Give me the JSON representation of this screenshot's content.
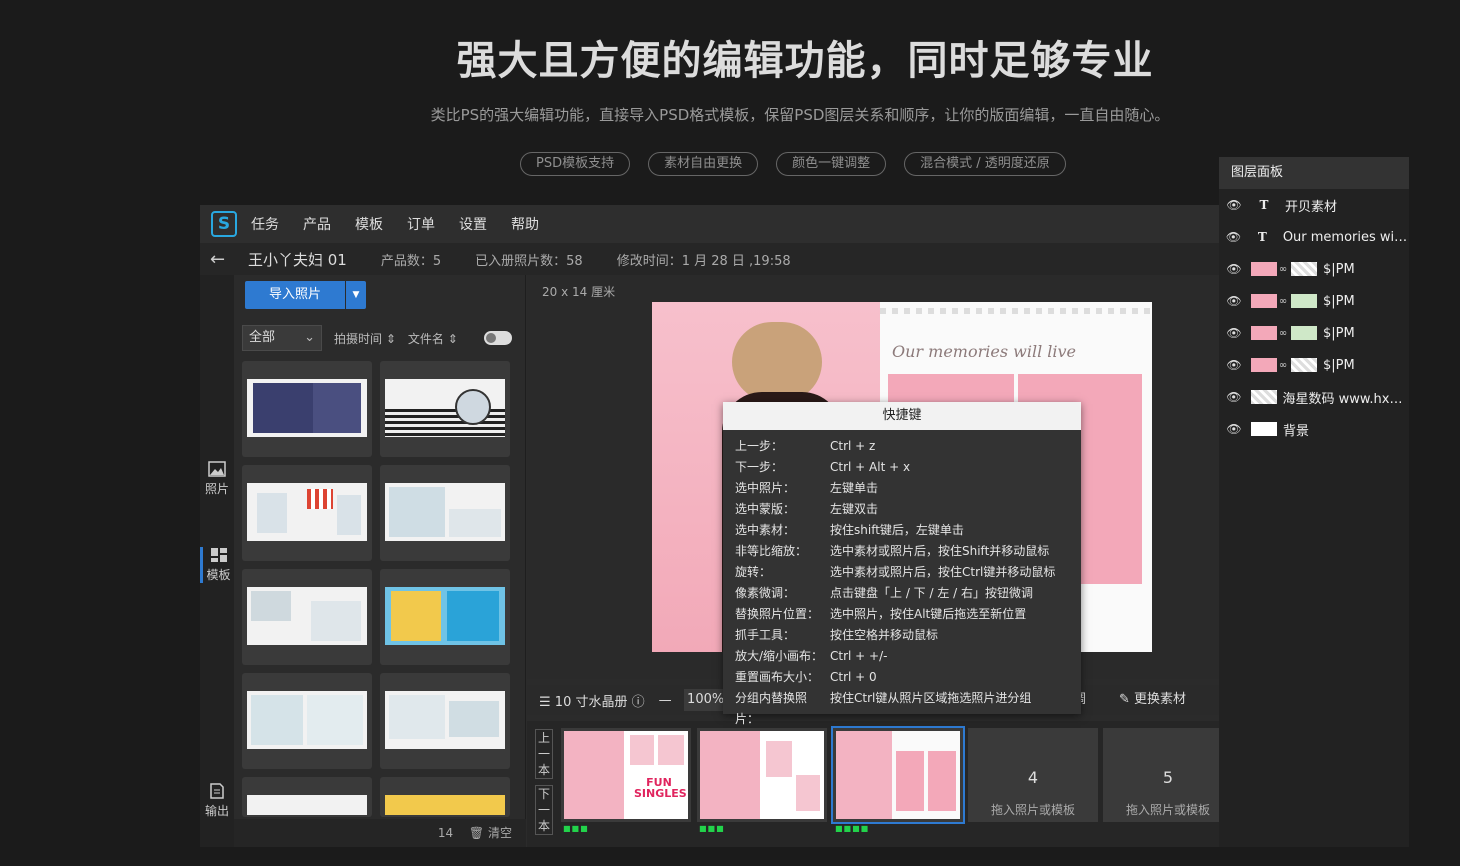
{
  "hero": {
    "title": "强大且方便的编辑功能，同时足够专业",
    "subtitle": "类比PS的强大编辑功能，直接导入PSD格式模板，保留PSD图层关系和顺序，让你的版面编辑，一直自由随心。",
    "tags": [
      "PSD模板支持",
      "素材自由更换",
      "颜色一键调整",
      "混合模式 / 透明度还原"
    ]
  },
  "app": {
    "logo": "S",
    "menu": [
      "任务",
      "产品",
      "模板",
      "订单",
      "设置",
      "帮助"
    ],
    "info": {
      "album_name": "王小丫夫妇 01",
      "product_count": "产品数：5",
      "photo_count": "已入册照片数：58",
      "modified": "修改时间：1 月 28 日 ,19:58"
    },
    "leftbar": {
      "photos": "照片",
      "templates": "模板",
      "export": "输出"
    },
    "photo_panel": {
      "import_label": "导入照片",
      "filter_all": "全部",
      "sort_time": "拍摄时间",
      "sort_name": "文件名",
      "footer_count": "14",
      "footer_clear": "清空"
    },
    "canvas": {
      "size_label": "20 x 14 厘米",
      "memories_text": "Our memories will live"
    },
    "toolbar": {
      "album_type": "10 寸水晶册",
      "zoom": "100%",
      "adjust_fragment": "调",
      "replace_material": "更换素材"
    },
    "filmstrip": {
      "nav_prev": [
        "上",
        "一",
        "本"
      ],
      "nav_next": [
        "下",
        "一",
        "本"
      ],
      "fun_text": "FUN SINGLES",
      "empty_pages": [
        {
          "num": "4",
          "hint": "拖入照片或模板"
        },
        {
          "num": "5",
          "hint": "拖入照片或模板"
        }
      ]
    }
  },
  "shortcuts": {
    "title": "快捷键",
    "items": [
      {
        "key": "上一步：",
        "value": "Ctrl + z"
      },
      {
        "key": "下一步：",
        "value": "Ctrl + Alt + x"
      },
      {
        "key": "选中照片：",
        "value": "左键单击"
      },
      {
        "key": "选中蒙版：",
        "value": "左键双击"
      },
      {
        "key": "选中素材：",
        "value": "按住shift键后，左键单击"
      },
      {
        "key": "非等比缩放：",
        "value": "选中素材或照片后，按住Shift并移动鼠标"
      },
      {
        "key": "旋转：",
        "value": "选中素材或照片后，按住Ctrl键并移动鼠标"
      },
      {
        "key": "像素微调：",
        "value": "点击键盘「上 / 下 / 左 / 右」按钮微调"
      },
      {
        "key": "替换照片位置：",
        "value": "选中照片，按住Alt键后拖选至新位置"
      },
      {
        "key": "抓手工具：",
        "value": "按住空格并移动鼠标"
      },
      {
        "key": "放大/缩小画布：",
        "value": "Ctrl + +/-"
      },
      {
        "key": "重置画布大小：",
        "value": "Ctrl + 0"
      },
      {
        "key": "分组内替换照片：",
        "value": "按住Ctrl键从照片区域拖选照片进分组"
      }
    ]
  },
  "layers": {
    "title": "图层面板",
    "items": [
      "开贝素材",
      "Our memories will...",
      "$|PM",
      "$|PM",
      "$|PM",
      "$|PM",
      "海星数码 www.hxp...",
      "背景"
    ]
  }
}
